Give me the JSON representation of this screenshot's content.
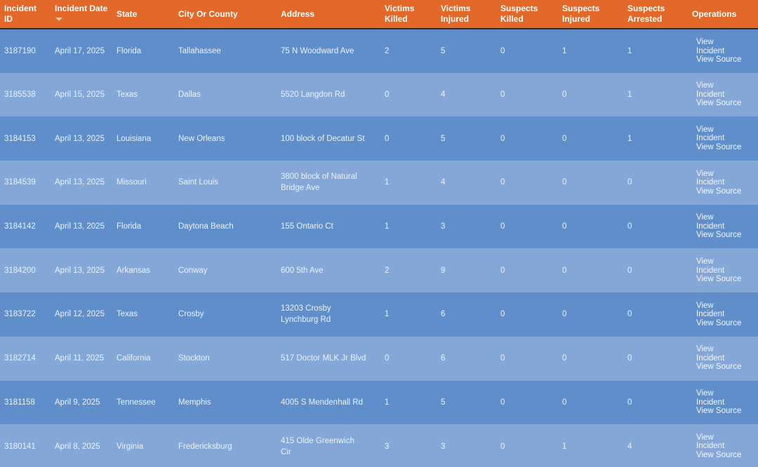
{
  "columns": {
    "incident_id": "Incident ID",
    "incident_date": "Incident Date",
    "state": "State",
    "city_or_county": "City Or County",
    "address": "Address",
    "victims_killed": "Victims Killed",
    "victims_injured": "Victims Injured",
    "suspects_killed": "Suspects Killed",
    "suspects_injured": "Suspects Injured",
    "suspects_arrested": "Suspects Arrested",
    "operations": "Operations"
  },
  "sort": {
    "column": "incident_date",
    "direction": "desc"
  },
  "operations_links": {
    "view_incident": "View Incident",
    "view_source": "View Source"
  },
  "rows": [
    {
      "id": "3187190",
      "date": "April 17, 2025",
      "state": "Florida",
      "city": "Tallahassee",
      "address": "75 N Woodward Ave",
      "victims_killed": "2",
      "victims_injured": "5",
      "suspects_killed": "0",
      "suspects_injured": "1",
      "suspects_arrested": "1"
    },
    {
      "id": "3185538",
      "date": "April 15, 2025",
      "state": "Texas",
      "city": "Dallas",
      "address": "5520 Langdon Rd",
      "victims_killed": "0",
      "victims_injured": "4",
      "suspects_killed": "0",
      "suspects_injured": "0",
      "suspects_arrested": "1"
    },
    {
      "id": "3184153",
      "date": "April 13, 2025",
      "state": "Louisiana",
      "city": "New Orleans",
      "address": "100 block of Decatur St",
      "victims_killed": "0",
      "victims_injured": "5",
      "suspects_killed": "0",
      "suspects_injured": "0",
      "suspects_arrested": "1"
    },
    {
      "id": "3184539",
      "date": "April 13, 2025",
      "state": "Missouri",
      "city": "Saint Louis",
      "address": "3800 block of Natural Bridge Ave",
      "victims_killed": "1",
      "victims_injured": "4",
      "suspects_killed": "0",
      "suspects_injured": "0",
      "suspects_arrested": "0"
    },
    {
      "id": "3184142",
      "date": "April 13, 2025",
      "state": "Florida",
      "city": "Daytona Beach",
      "address": "155 Ontario Ct",
      "victims_killed": "1",
      "victims_injured": "3",
      "suspects_killed": "0",
      "suspects_injured": "0",
      "suspects_arrested": "0"
    },
    {
      "id": "3184200",
      "date": "April 13, 2025",
      "state": "Arkansas",
      "city": "Conway",
      "address": "600 5th Ave",
      "victims_killed": "2",
      "victims_injured": "9",
      "suspects_killed": "0",
      "suspects_injured": "0",
      "suspects_arrested": "0"
    },
    {
      "id": "3183722",
      "date": "April 12, 2025",
      "state": "Texas",
      "city": "Crosby",
      "address": "13203 Crosby Lynchburg Rd",
      "victims_killed": "1",
      "victims_injured": "6",
      "suspects_killed": "0",
      "suspects_injured": "0",
      "suspects_arrested": "0"
    },
    {
      "id": "3182714",
      "date": "April 11, 2025",
      "state": "California",
      "city": "Stockton",
      "address": "517 Doctor MLK Jr Blvd",
      "victims_killed": "0",
      "victims_injured": "6",
      "suspects_killed": "0",
      "suspects_injured": "0",
      "suspects_arrested": "0"
    },
    {
      "id": "3181158",
      "date": "April 9, 2025",
      "state": "Tennessee",
      "city": "Memphis",
      "address": "4005 S Mendenhall Rd",
      "victims_killed": "1",
      "victims_injured": "5",
      "suspects_killed": "0",
      "suspects_injured": "0",
      "suspects_arrested": "0"
    },
    {
      "id": "3180141",
      "date": "April 8, 2025",
      "state": "Virginia",
      "city": "Fredericksburg",
      "address": "415 Olde Greenwich Cir",
      "victims_killed": "3",
      "victims_injured": "3",
      "suspects_killed": "0",
      "suspects_injured": "1",
      "suspects_arrested": "4"
    }
  ],
  "colors": {
    "header_bg": "#e2692a",
    "row_odd_bg": "#5f8ecb",
    "row_even_bg": "#84a7d8",
    "text": "#eef3fb"
  }
}
